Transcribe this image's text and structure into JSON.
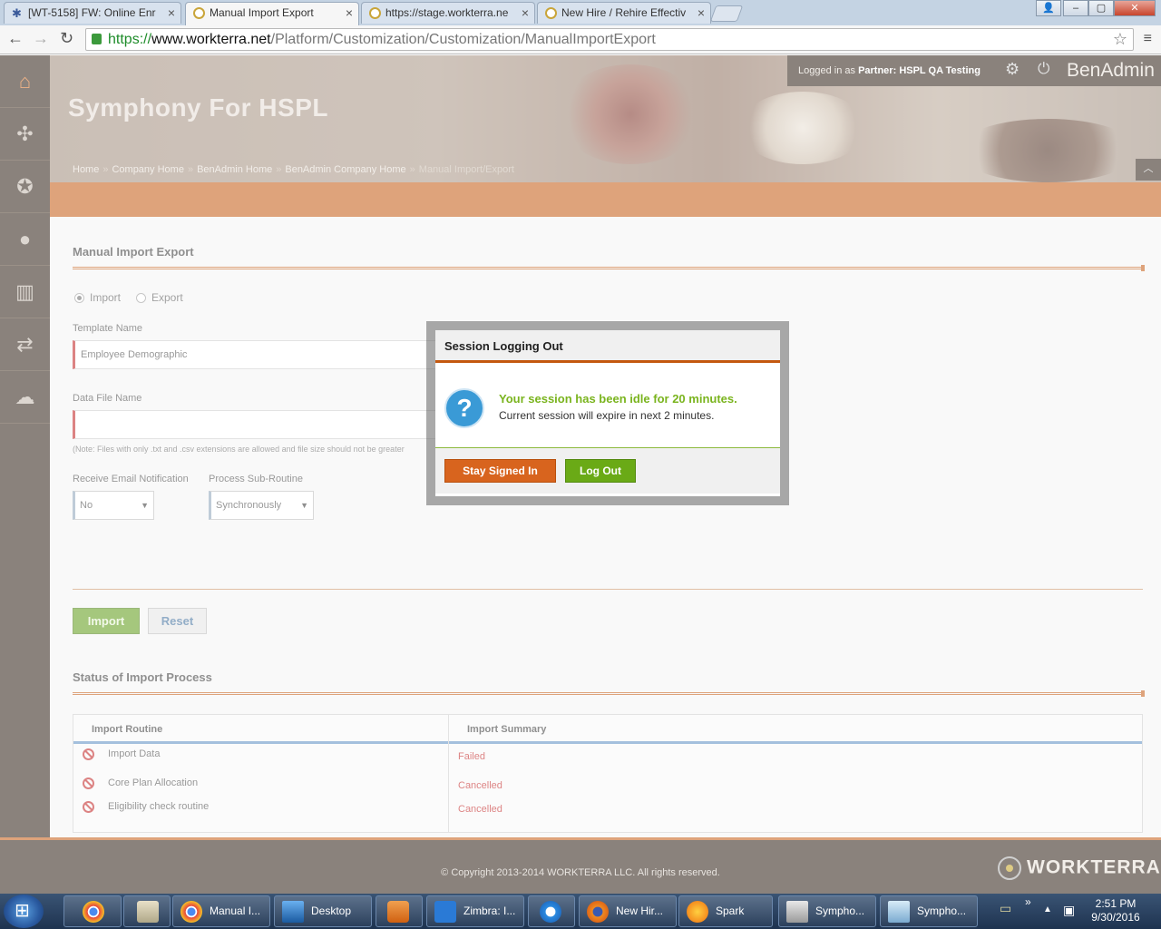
{
  "browser": {
    "tabs": [
      {
        "label": "[WT-5158] FW: Online Enr",
        "active": false
      },
      {
        "label": "Manual Import Export",
        "active": true
      },
      {
        "label": "https://stage.workterra.ne",
        "active": false
      },
      {
        "label": "New Hire / Rehire Effectiv",
        "active": false
      }
    ],
    "url_scheme": "https://",
    "url_host": "www.workterra.net",
    "url_path": "/Platform/Customization/Customization/ManualImportExport"
  },
  "header": {
    "site_title": "Symphony For HSPL",
    "logged_in_prefix": "Logged in as",
    "logged_in_role": "Partner:",
    "logged_in_name": "HSPL QA Testing",
    "brand": "BenAdmin",
    "breadcrumb": [
      "Home",
      "Company Home",
      "BenAdmin Home",
      "BenAdmin Company Home",
      "Manual Import/Export"
    ],
    "breadcrumb_sep": "»"
  },
  "form": {
    "title": "Manual Import Export",
    "radio_import": "Import",
    "radio_export": "Export",
    "template_label": "Template Name",
    "template_value": "Employee Demographic",
    "datafile_label": "Data File Name",
    "note": "(Note: Files with only .txt and .csv extensions are allowed and file size should not be greater",
    "email_label": "Receive Email Notification",
    "email_value": "No",
    "subroutine_label": "Process Sub-Routine",
    "subroutine_value": "Synchronously",
    "import_button": "Import",
    "reset_button": "Reset"
  },
  "status": {
    "title": "Status of Import Process",
    "col_routine": "Import Routine",
    "col_summary": "Import Summary",
    "rows": [
      {
        "routine": "Import Data",
        "summary": "Failed"
      },
      {
        "routine": "Core Plan Allocation",
        "summary": "Cancelled"
      },
      {
        "routine": "Eligibility check routine",
        "summary": "Cancelled"
      }
    ]
  },
  "footer": {
    "copyright": "© Copyright 2013-2014 WORKTERRA LLC. All rights reserved.",
    "logo": "WORKTERRA"
  },
  "modal": {
    "title": "Session Logging Out",
    "message_primary": "Your session has been idle for 20 minutes.",
    "message_secondary": "Current session will expire in next 2 minutes.",
    "stay_button": "Stay Signed In",
    "logout_button": "Log Out"
  },
  "taskbar": {
    "items": [
      "Manual I...",
      "Desktop",
      "Zimbra: I...",
      "New Hir...",
      "Spark",
      "Sympho...",
      "Sympho..."
    ],
    "time": "2:51 PM",
    "date": "9/30/2016"
  },
  "colors": {
    "accent_orange": "#c4580f",
    "accent_green": "#6aaa16",
    "error_red": "#c01e1e",
    "sidebar_dark": "#2a1d12"
  }
}
